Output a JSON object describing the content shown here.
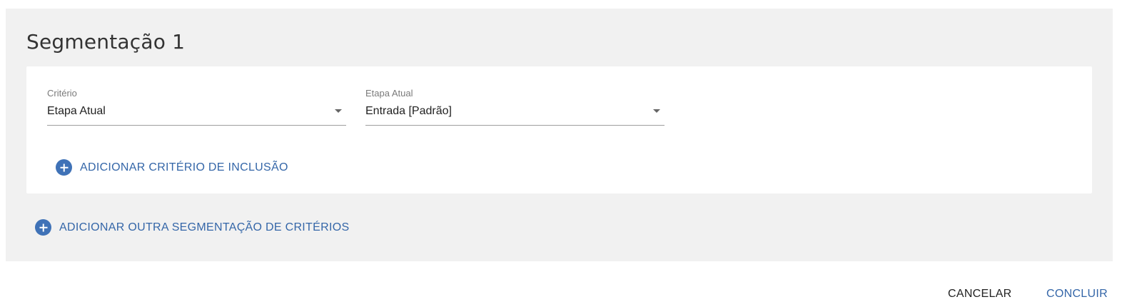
{
  "segment": {
    "title": "Segmentação 1",
    "fields": [
      {
        "label": "Critério",
        "value": "Etapa Atual"
      },
      {
        "label": "Etapa Atual",
        "value": "Entrada [Padrão]"
      }
    ],
    "add_inclusion_label": "ADICIONAR CRITÉRIO DE INCLUSÃO"
  },
  "add_segmentation_label": "ADICIONAR OUTRA SEGMENTAÇÃO DE CRITÉRIOS",
  "footer": {
    "cancel_label": "CANCELAR",
    "confirm_label": "CONCLUIR"
  },
  "colors": {
    "accent": "#3f72b7",
    "panel_background": "#f1f1f1",
    "card_background": "#ffffff"
  },
  "icons": {
    "add": "plus-circle-icon",
    "dropdown": "caret-down-icon"
  }
}
